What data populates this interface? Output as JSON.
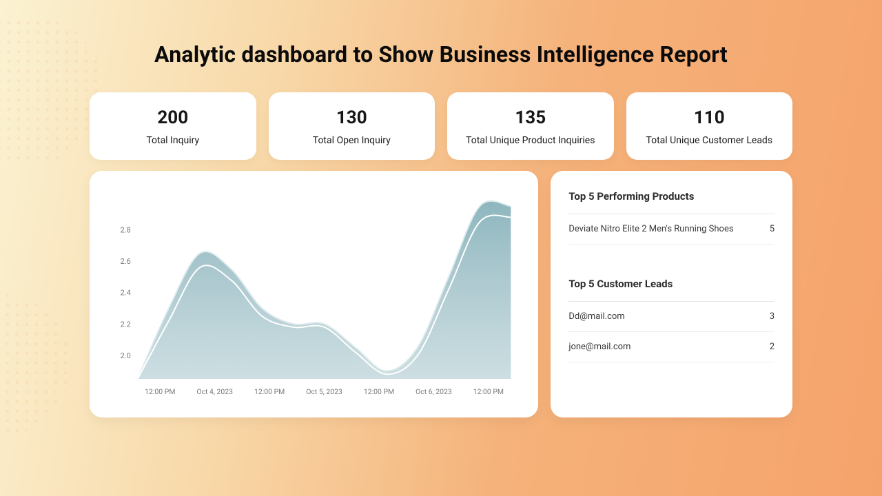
{
  "title": "Analytic dashboard to Show Business Intelligence Report",
  "stats": [
    {
      "value": "200",
      "label": "Total Inquiry"
    },
    {
      "value": "130",
      "label": "Total Open Inquiry"
    },
    {
      "value": "135",
      "label": "Total Unique Product Inquiries"
    },
    {
      "value": "110",
      "label": "Total Unique Customer Leads"
    }
  ],
  "side": {
    "products_title": "Top 5 Performing Products",
    "products": [
      {
        "name": "Deviate Nitro Elite 2 Men's Running Shoes",
        "count": "5"
      }
    ],
    "leads_title": "Top 5 Customer Leads",
    "leads": [
      {
        "name": "Dd@mail.com",
        "count": "3"
      },
      {
        "name": "jone@mail.com",
        "count": "2"
      }
    ]
  },
  "chart_data": {
    "type": "area",
    "title": "",
    "xlabel": "",
    "ylabel": "",
    "ylim": [
      1.85,
      3.0
    ],
    "y_ticks": [
      2.0,
      2.2,
      2.4,
      2.6,
      2.8
    ],
    "x_ticks": [
      "12:00 PM",
      "Oct 4, 2023",
      "12:00 PM",
      "Oct 5, 2023",
      "12:00 PM",
      "Oct 6, 2023",
      "12:00 PM"
    ],
    "series": [
      {
        "name": "series_a",
        "color_fill": "#8db6bf",
        "color_line": "#e8f2f4",
        "values": [
          1.85,
          2.3,
          2.65,
          2.55,
          2.3,
          2.2,
          2.2,
          2.05,
          1.9,
          2.05,
          2.5,
          2.95,
          2.95
        ]
      },
      {
        "name": "series_b",
        "color_line": "#ffffff",
        "values": [
          1.85,
          2.22,
          2.56,
          2.48,
          2.25,
          2.18,
          2.18,
          2.02,
          1.88,
          2.0,
          2.42,
          2.85,
          2.88
        ]
      }
    ]
  }
}
